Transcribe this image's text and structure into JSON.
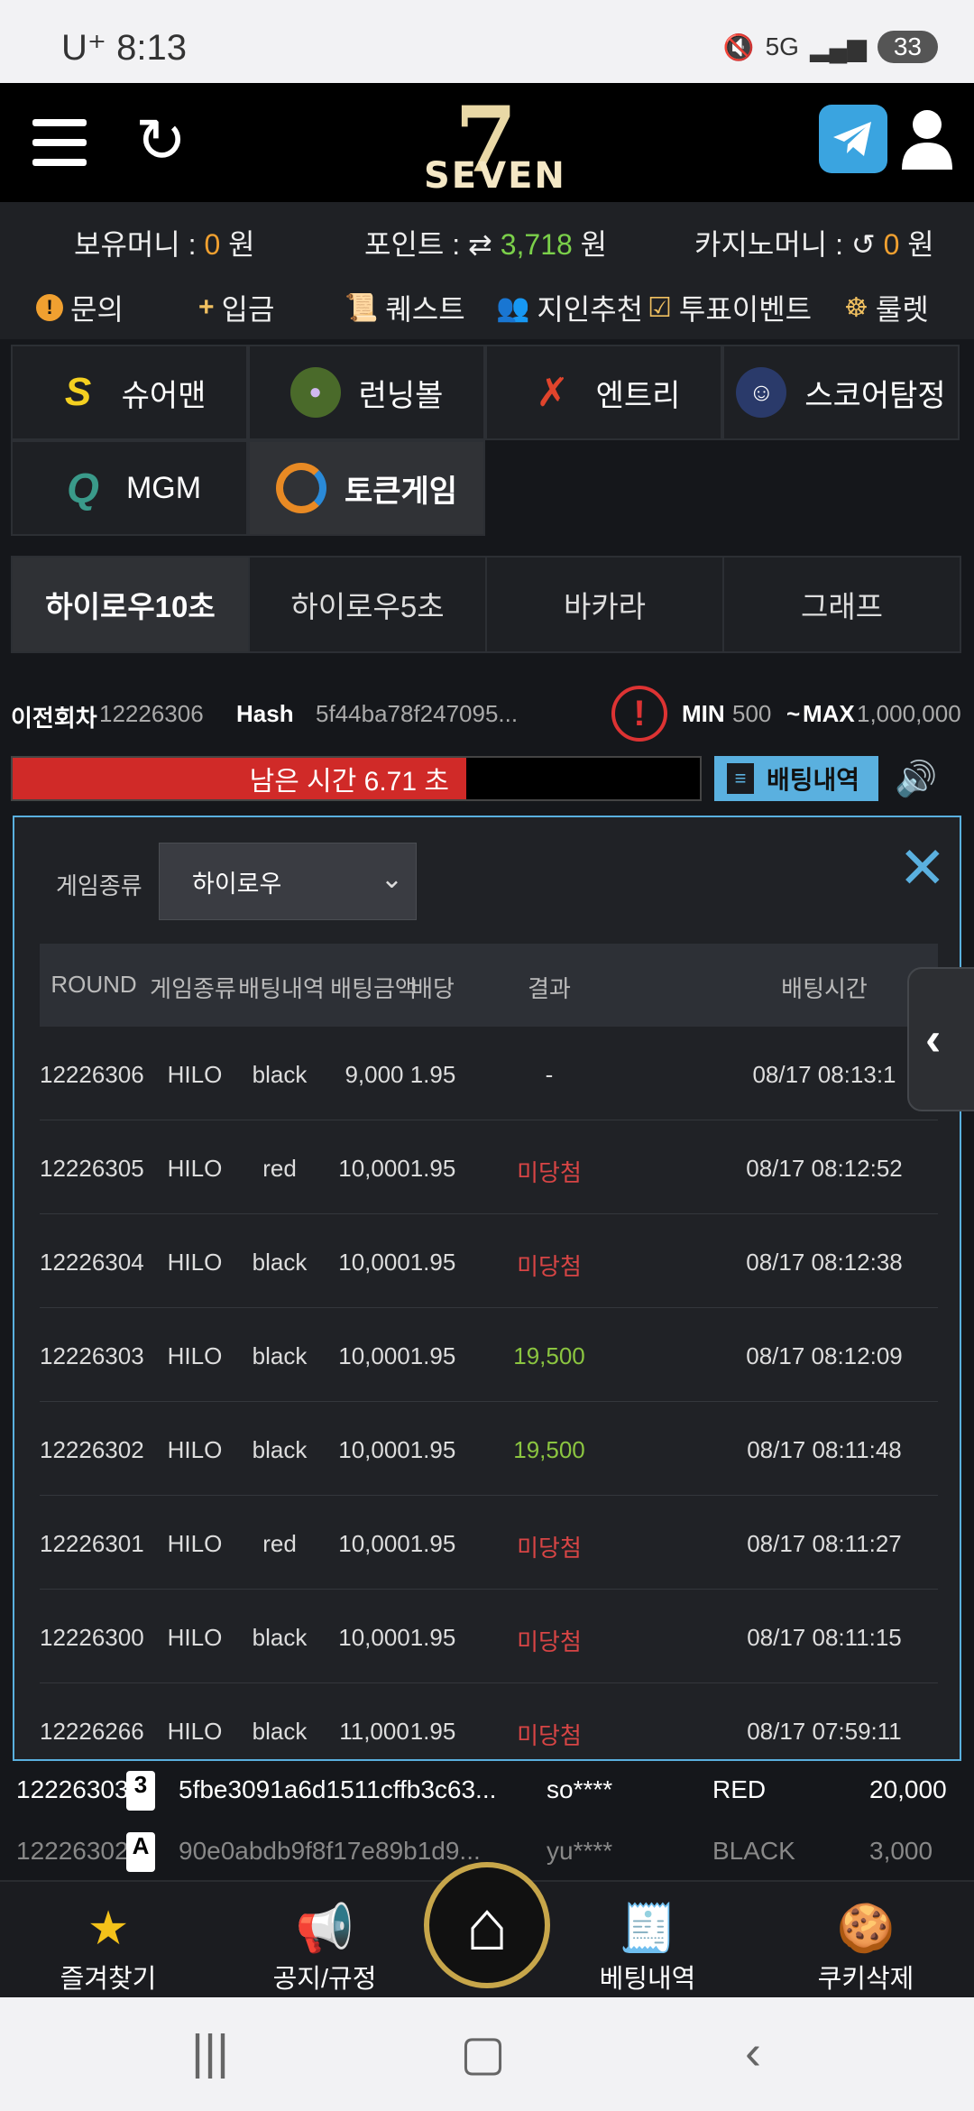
{
  "status": {
    "carrier": "U⁺ 8:13",
    "network": "5G",
    "battery": "33"
  },
  "header": {
    "logo_word": "SEVEN",
    "logo_number": "7"
  },
  "balances": {
    "holding_label": "보유머니 :",
    "holding_value": "0",
    "holding_unit": "원",
    "points_label": "포인트 :",
    "points_value": "3,718",
    "points_unit": "원",
    "casino_label": "카지노머니 :",
    "casino_value": "0",
    "casino_unit": "원"
  },
  "quick_menu": [
    {
      "label": "문의",
      "icon": "exclamation-icon"
    },
    {
      "label": "입금",
      "icon": "plus-icon"
    },
    {
      "label": "퀘스트",
      "icon": "scroll-icon"
    },
    {
      "label": "지인추천",
      "icon": "people-icon"
    },
    {
      "label": "투표이벤트",
      "icon": "check-box-icon"
    },
    {
      "label": "룰렛",
      "icon": "roulette-icon"
    }
  ],
  "games": [
    {
      "label": "슈어맨"
    },
    {
      "label": "런닝볼"
    },
    {
      "label": "엔트리"
    },
    {
      "label": "스코어탐정"
    },
    {
      "label": "MGM"
    },
    {
      "label": "토큰게임"
    }
  ],
  "sub_tabs": [
    "하이로우10초",
    "하이로우5초",
    "바카라",
    "그래프"
  ],
  "round_info": {
    "prev_label": "이전회차",
    "prev_value": "12226306",
    "hash_label": "Hash",
    "hash_value": "5f44ba78f247095...",
    "min_label": "MIN",
    "min_value": "500",
    "tilde": "~",
    "max_label": "MAX",
    "max_value": "1,000,000"
  },
  "timer": {
    "text": "남은 시간 6.71 초",
    "progress": 0.66
  },
  "history_button": "배팅내역",
  "modal": {
    "filter_label": "게임종류",
    "filter_value": "하이로우",
    "columns": [
      "ROUND",
      "게임종류",
      "배팅내역",
      "배팅금액",
      "배당",
      "결과",
      "배팅시간"
    ],
    "rows": [
      {
        "round": "12226306",
        "game": "HILO",
        "bet": "black",
        "amount": "9,000",
        "odds": "1.95",
        "result": "-",
        "status": "pending",
        "time": "08/17 08:13:1"
      },
      {
        "round": "12226305",
        "game": "HILO",
        "bet": "red",
        "amount": "10,000",
        "odds": "1.95",
        "result": "미당첨",
        "status": "lose",
        "time": "08/17 08:12:52"
      },
      {
        "round": "12226304",
        "game": "HILO",
        "bet": "black",
        "amount": "10,000",
        "odds": "1.95",
        "result": "미당첨",
        "status": "lose",
        "time": "08/17 08:12:38"
      },
      {
        "round": "12226303",
        "game": "HILO",
        "bet": "black",
        "amount": "10,000",
        "odds": "1.95",
        "result": "19,500",
        "status": "win",
        "time": "08/17 08:12:09"
      },
      {
        "round": "12226302",
        "game": "HILO",
        "bet": "black",
        "amount": "10,000",
        "odds": "1.95",
        "result": "19,500",
        "status": "win",
        "time": "08/17 08:11:48"
      },
      {
        "round": "12226301",
        "game": "HILO",
        "bet": "red",
        "amount": "10,000",
        "odds": "1.95",
        "result": "미당첨",
        "status": "lose",
        "time": "08/17 08:11:27"
      },
      {
        "round": "12226300",
        "game": "HILO",
        "bet": "black",
        "amount": "10,000",
        "odds": "1.95",
        "result": "미당첨",
        "status": "lose",
        "time": "08/17 08:11:15"
      },
      {
        "round": "12226266",
        "game": "HILO",
        "bet": "black",
        "amount": "11,000",
        "odds": "1.95",
        "result": "미당첨",
        "status": "lose",
        "time": "08/17 07:59:11"
      }
    ]
  },
  "background_rows": [
    {
      "round": "12226303",
      "card": "3",
      "hash": "5fbe3091a6d1511cffb3c63...",
      "user": "so****",
      "bet": "RED",
      "amount": "20,000"
    },
    {
      "round": "12226302",
      "card": "A",
      "hash": "90e0abdb9f8f17e89b1d9...",
      "user": "yu****",
      "bet": "BLACK",
      "amount": "3,000"
    }
  ],
  "bottom_nav": [
    {
      "label": "즐겨찾기",
      "icon": "star-icon"
    },
    {
      "label": "공지/규정",
      "icon": "megaphone-icon"
    },
    {
      "label": "",
      "icon": "home-icon"
    },
    {
      "label": "베팅내역",
      "icon": "bet-slip-icon"
    },
    {
      "label": "쿠키삭제",
      "icon": "cookie-icon"
    }
  ],
  "colors": {
    "accent": "#5ab0df",
    "timer_red": "#d02a28",
    "lose": "#d84545",
    "win": "#8bc540",
    "gold": "#c7a64a"
  }
}
